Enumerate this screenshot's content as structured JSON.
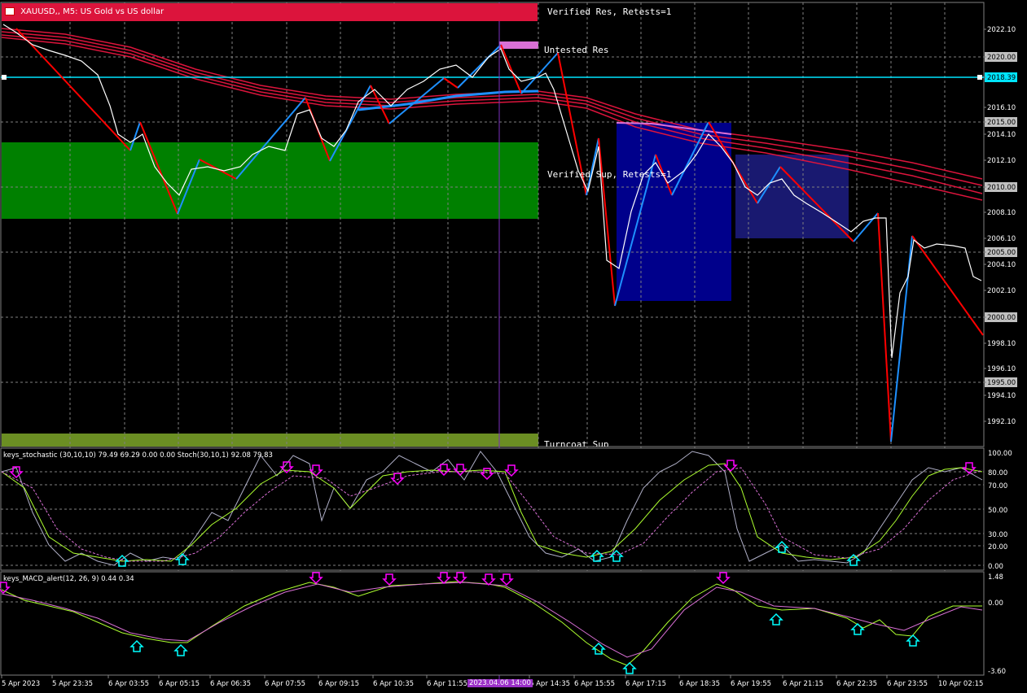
{
  "window": {
    "symbol_title": "XAUUSD,, M5:  US Gold vs US dollar"
  },
  "zones": {
    "verified_res": "Verified Res, Retests=1",
    "untested_res": "Untested Res",
    "verified_sup": "Verified Sup, Retests=1",
    "turncoat_sup": "Turncoat Sup"
  },
  "price_axis": {
    "labels": [
      "2022.10",
      "2020.00",
      "2018.39",
      "2016.10",
      "2015.00",
      "2014.10",
      "2012.10",
      "2010.00",
      "2008.10",
      "2006.10",
      "2005.00",
      "2004.10",
      "2002.10",
      "2000.00",
      "1998.10",
      "1996.10",
      "1995.00",
      "1994.10",
      "1992.10"
    ],
    "highlighted": [
      "2020.00",
      "2015.00",
      "2010.00",
      "2005.00",
      "2000.00",
      "1995.00"
    ],
    "current_line": "2018.39"
  },
  "stoch_panel": {
    "title": "keys_stochastic (30,10,10) 79.49 69.29 0.00 0.00 Stoch(30,10,1) 92.08 79.83",
    "levels": [
      "100.00",
      "80.00",
      "70.00",
      "50.00",
      "30.00",
      "20.00",
      "0.00"
    ]
  },
  "macd_panel": {
    "title": "keys_MACD_alert(12, 26, 9) 0.44 0.34",
    "levels": [
      "1.48",
      "0.00",
      "-3.60"
    ]
  },
  "time_axis": {
    "labels": [
      "5 Apr 2023",
      "5 Apr 23:35",
      "6 Apr 03:55",
      "6 Apr 05:15",
      "6 Apr 06:35",
      "6 Apr 07:55",
      "6 Apr 09:15",
      "6 Apr 10:35",
      "6 Apr 11:55",
      "6 Apr 14:35",
      "6 Apr 15:55",
      "6 Apr 17:15",
      "6 Apr 18:35",
      "6 Apr 19:55",
      "6 Apr 21:15",
      "6 Apr 22:35",
      "6 Apr 23:55",
      "10 Apr 02:15"
    ],
    "crosshair_label": "2023.04.06 14:00"
  },
  "colors": {
    "background": "#000000",
    "resistance_header": "#dc143c",
    "support_zone": "#008000",
    "turncoat_zone": "#6b8e23",
    "untested_zone": "#da70d6",
    "blue_box": "#00008b",
    "blue_box_light": "#191970",
    "ma_red": "#dc143c",
    "zigzag_up": "#1e90ff",
    "zigzag_down": "#ff0000",
    "current_line": "#00e5ff",
    "crosshair": "#7b2fbe",
    "grid": "#808080"
  },
  "icons": {
    "header": "chart-window-icon",
    "stoch_signal_down": "magenta-down-arrow-icon",
    "stoch_signal_up": "cyan-up-arrow-icon"
  }
}
